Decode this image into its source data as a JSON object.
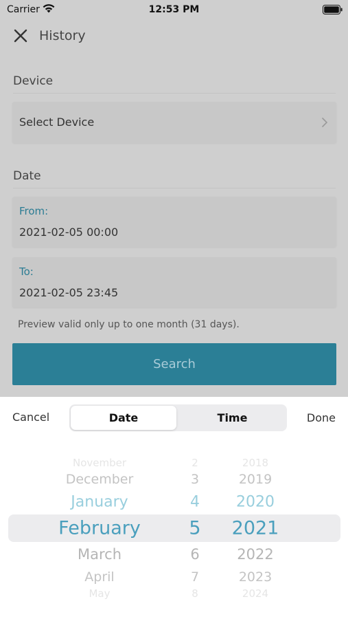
{
  "status_bar": {
    "carrier": "Carrier",
    "time": "12:53 PM"
  },
  "nav": {
    "title": "History",
    "close_icon": "close-icon"
  },
  "device_section": {
    "label": "Device",
    "select_label": "Select Device"
  },
  "date_section": {
    "label": "Date",
    "from_label": "From:",
    "from_value": "2021-02-05 00:00",
    "to_label": "To:",
    "to_value": "2021-02-05 23:45"
  },
  "note": "Preview valid only up to one month (31 days).",
  "search_label": "Search",
  "picker": {
    "cancel_label": "Cancel",
    "done_label": "Done",
    "segments": [
      "Date",
      "Time"
    ],
    "active_segment": "Date",
    "months": [
      "November",
      "December",
      "January",
      "February",
      "March",
      "April",
      "May"
    ],
    "days": [
      "2",
      "3",
      "4",
      "5",
      "6",
      "7",
      "8"
    ],
    "years": [
      "2018",
      "2019",
      "2020",
      "2021",
      "2022",
      "2023",
      "2024"
    ],
    "selected_month": "February",
    "selected_day": "5",
    "selected_year": "2021"
  },
  "colors": {
    "accent": "#2b7f96",
    "picker_selected": "#4a9fbd",
    "label_blue": "#2b7c93",
    "overlay_gray": "#cfcfcf"
  }
}
